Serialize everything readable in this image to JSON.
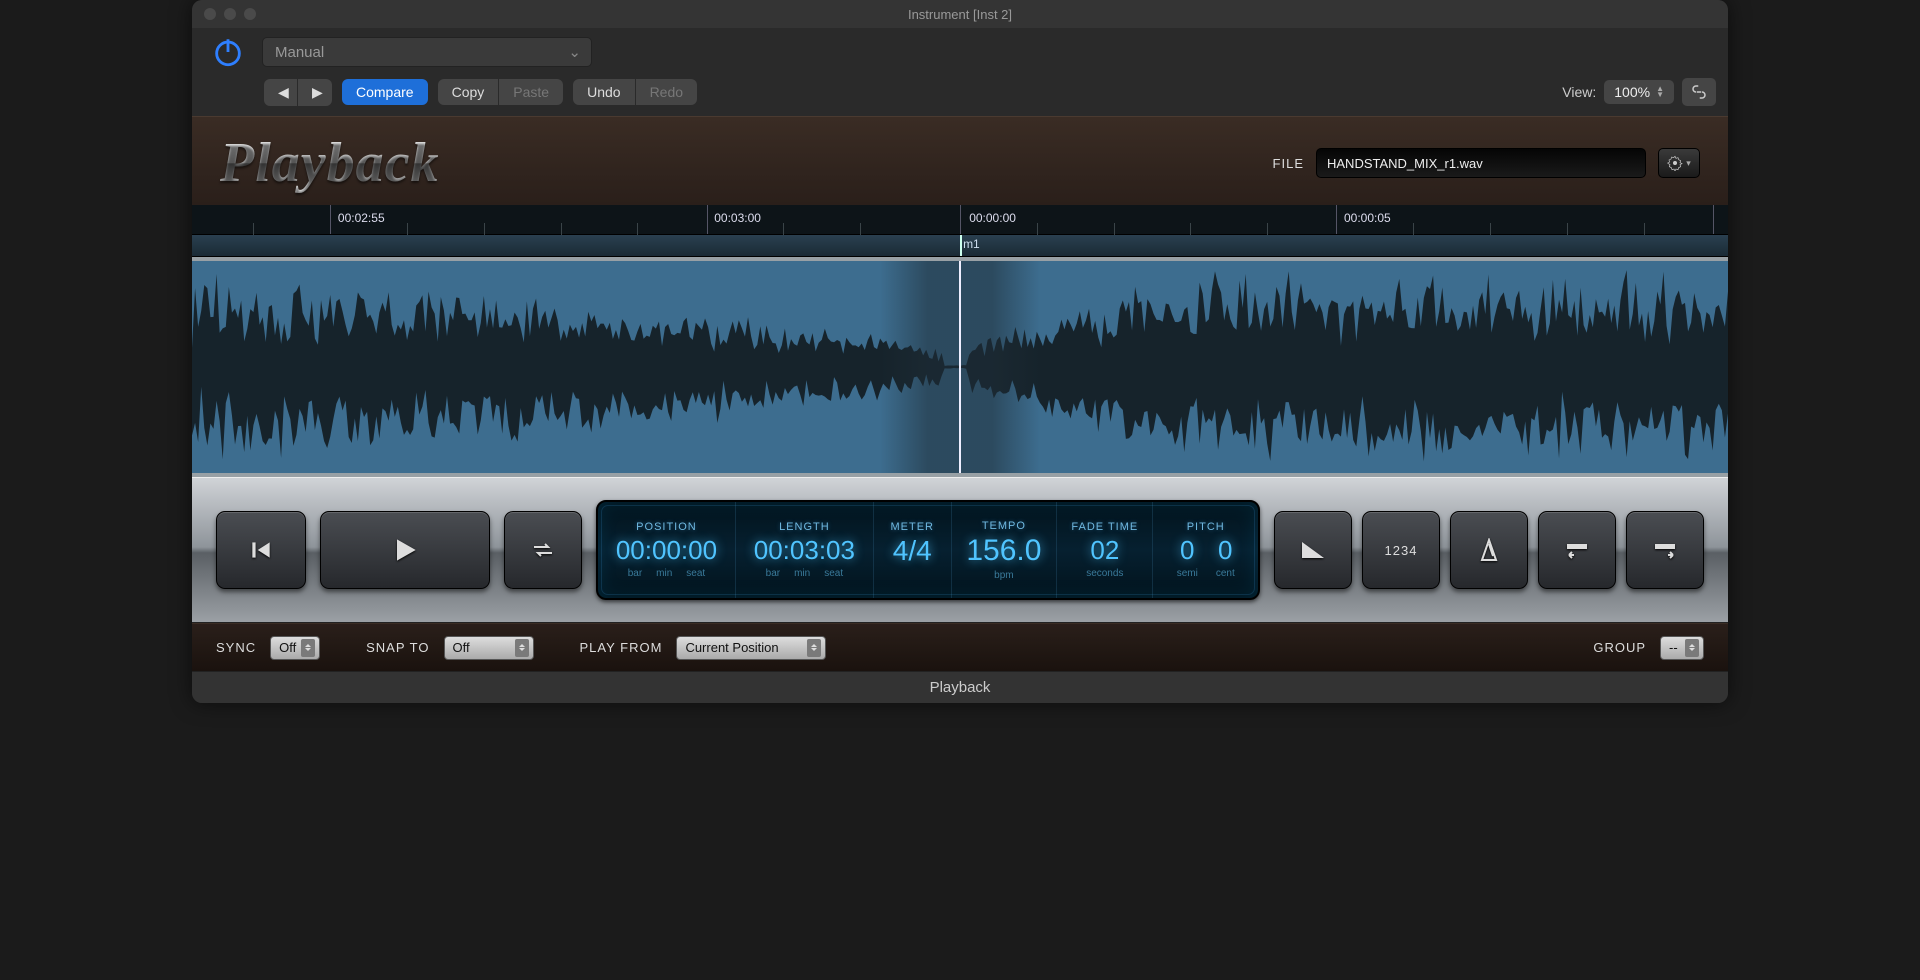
{
  "window_title": "Instrument [Inst 2]",
  "toolbar": {
    "preset": "Manual",
    "compare": "Compare",
    "copy": "Copy",
    "paste": "Paste",
    "undo": "Undo",
    "redo": "Redo",
    "view_label": "View:",
    "zoom": "100%"
  },
  "plugin": {
    "logo": "Playback",
    "file_label": "FILE",
    "file_name": "HANDSTAND_MIX_r1.wav",
    "ruler_times": [
      "00:02:55",
      "00:03:00",
      "00:00:00",
      "00:00:05"
    ],
    "measure_label": "m1",
    "lcd": {
      "position": {
        "label": "POSITION",
        "value": "00:00:00",
        "sub": [
          "bar",
          "min",
          "seat"
        ]
      },
      "length": {
        "label": "LENGTH",
        "value": "00:03:03",
        "sub": [
          "bar",
          "min",
          "seat"
        ]
      },
      "meter": {
        "label": "METER",
        "value": "4/4"
      },
      "tempo": {
        "label": "TEMPO",
        "value": "156.0",
        "sub": "bpm"
      },
      "fade": {
        "label": "FADE TIME",
        "value": "2",
        "sub": "seconds",
        "dim_prefix": "0"
      },
      "pitch": {
        "label": "PITCH",
        "semi": "0",
        "cent": "0",
        "semi_lbl": "semi",
        "cent_lbl": "cent"
      }
    },
    "footer": {
      "sync_label": "SYNC",
      "sync_value": "Off",
      "snap_label": "SNAP TO",
      "snap_value": "Off",
      "playfrom_label": "PLAY FROM",
      "playfrom_value": "Current Position",
      "group_label": "GROUP",
      "group_value": "--"
    }
  },
  "status_bar": "Playback"
}
